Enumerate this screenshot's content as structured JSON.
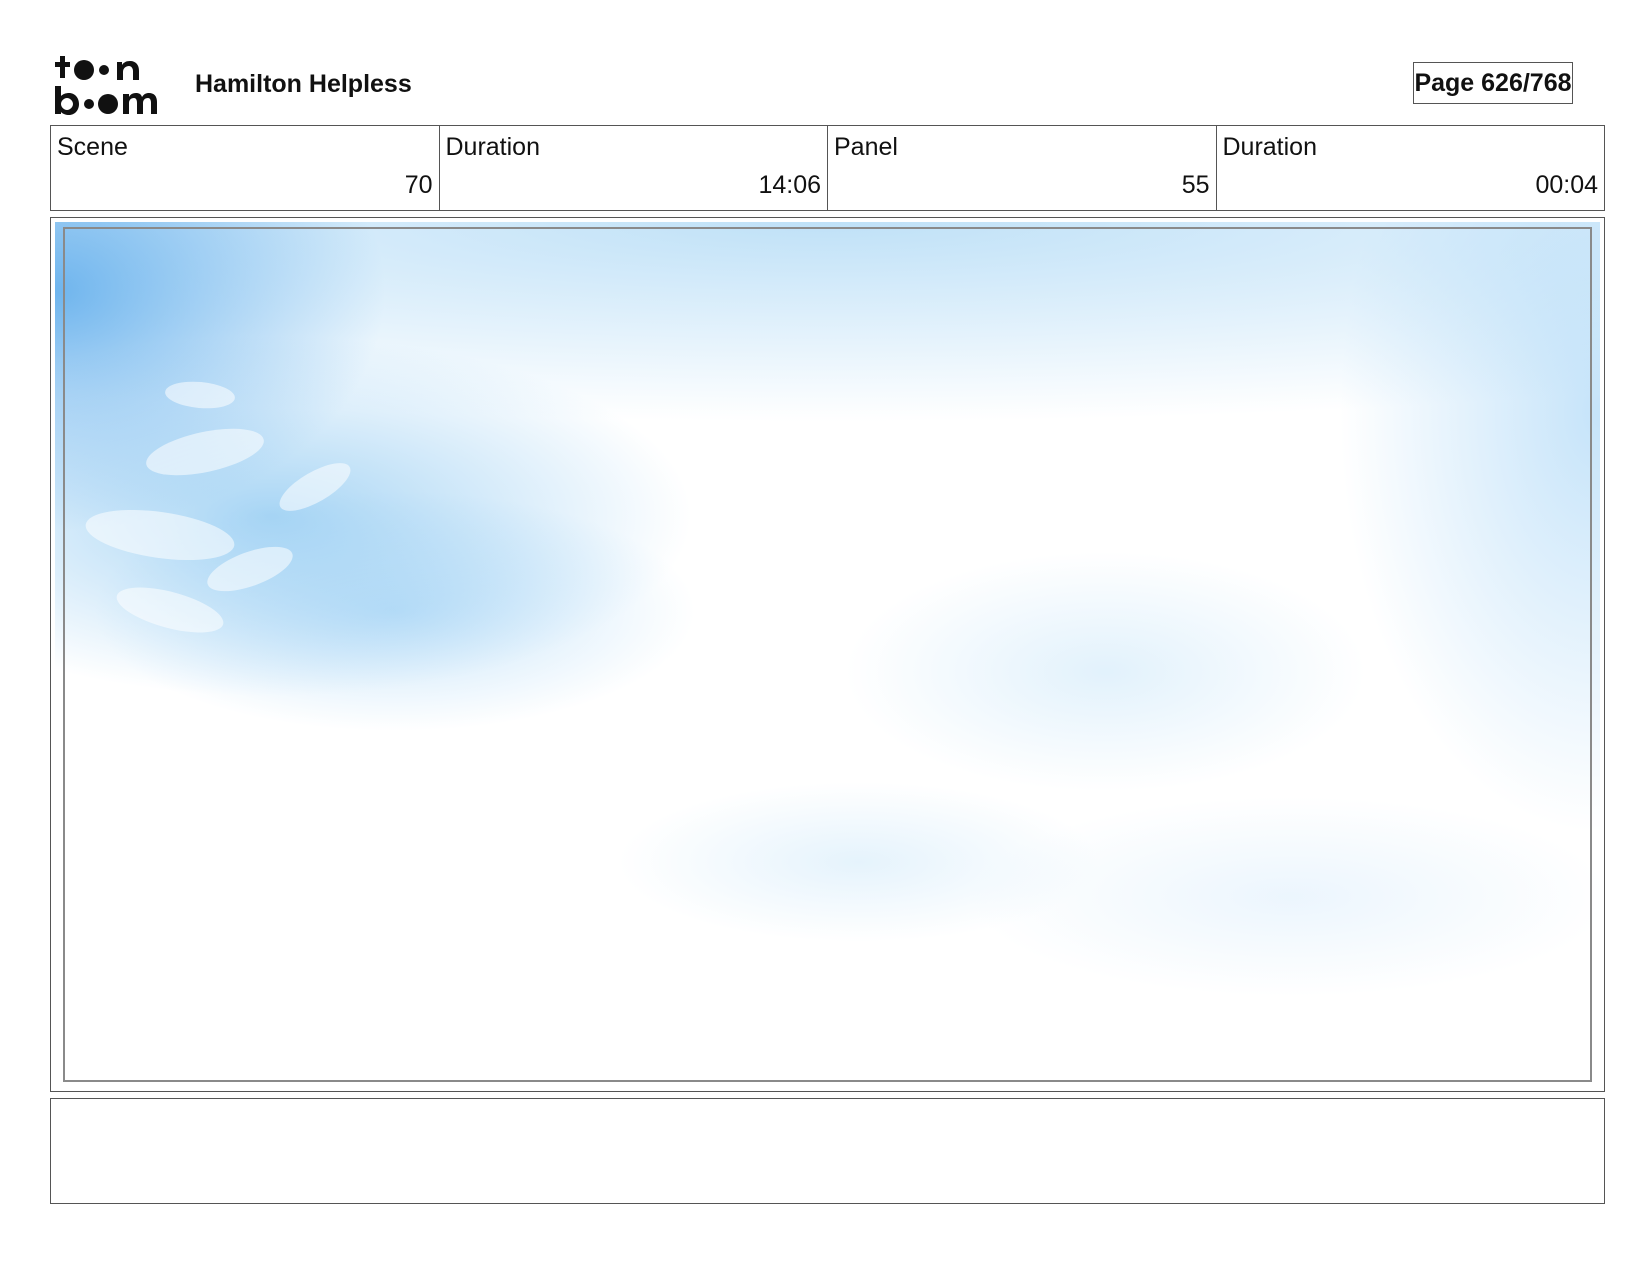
{
  "header": {
    "logo_text_top": "toon",
    "logo_text_bottom": "boom",
    "project_title": "Hamilton Helpless",
    "page_indicator": "Page 626/768"
  },
  "info": {
    "scene_label": "Scene",
    "scene_value": "70",
    "scene_duration_label": "Duration",
    "scene_duration_value": "14:06",
    "panel_label": "Panel",
    "panel_value": "55",
    "panel_duration_label": "Duration",
    "panel_duration_value": "00:04"
  },
  "panel": {
    "image_description_icon": "storyboard-panel-icon",
    "dominant_color": "#a9d6f5"
  },
  "caption": {
    "text": ""
  }
}
